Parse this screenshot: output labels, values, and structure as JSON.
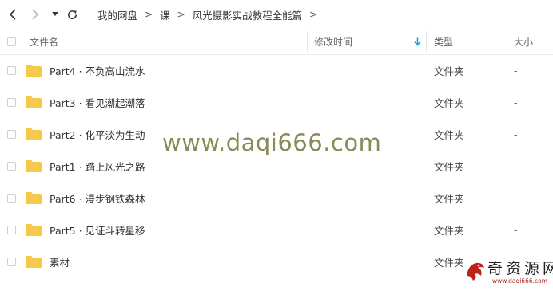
{
  "breadcrumb": [
    "我的网盘",
    "课",
    "风光摄影实战教程全能篇"
  ],
  "breadcrumb_sep": ">",
  "columns": {
    "name": "文件名",
    "modified": "修改时间",
    "type": "类型",
    "size": "大小"
  },
  "rows": [
    {
      "name": "Part4 · 不负高山流水",
      "type": "文件夹",
      "size": "-"
    },
    {
      "name": "Part3 · 看见潮起潮落",
      "type": "文件夹",
      "size": "-"
    },
    {
      "name": "Part2 · 化平淡为生动",
      "type": "文件夹",
      "size": "-"
    },
    {
      "name": "Part1 · 踏上风光之路",
      "type": "文件夹",
      "size": "-"
    },
    {
      "name": "Part6 · 漫步钢铁森林",
      "type": "文件夹",
      "size": "-"
    },
    {
      "name": "Part5 · 见证斗转星移",
      "type": "文件夹",
      "size": "-"
    },
    {
      "name": "素材",
      "type": "文件夹",
      "size": "-"
    }
  ],
  "watermark": "www.daqi666.com",
  "logo": {
    "text": "奇资源网",
    "url": "www.daqi666.com"
  },
  "colors": {
    "folder": "#f7c948",
    "sort_arrow": "#1aa0e8",
    "watermark": "#8a8a55"
  }
}
